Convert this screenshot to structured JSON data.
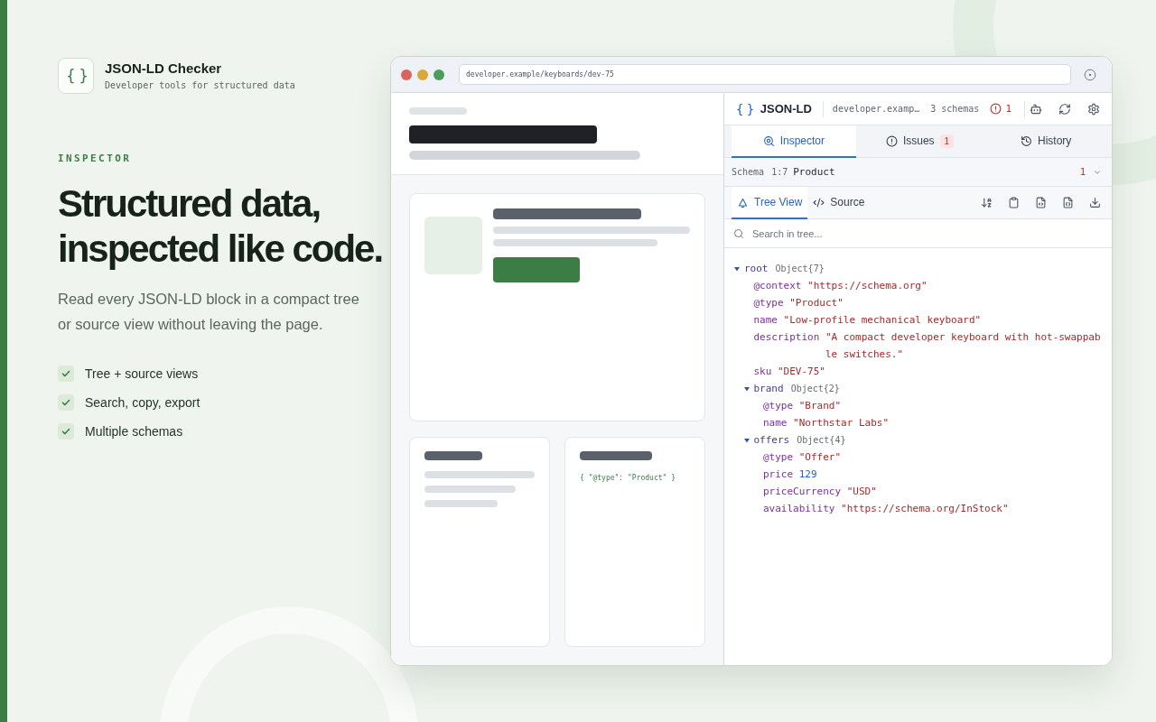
{
  "brand": {
    "logo": "{ }",
    "title": "JSON-LD Checker",
    "subtitle": "Developer tools for structured data"
  },
  "hero": {
    "eyebrow": "INSPECTOR",
    "headline": "Structured data, inspected like code.",
    "lead": "Read every JSON-LD block in a compact tree or source view without leaving the page.",
    "features": [
      "Tree + source views",
      "Search, copy, export",
      "Multiple schemas"
    ]
  },
  "browser": {
    "url": "developer.example/keyboards/dev-75",
    "page": {
      "code_snippet": "{ \"@type\": \"Product\" }"
    }
  },
  "panel": {
    "logo": "{ }",
    "title": "JSON-LD",
    "site": "developer.examp…",
    "schemas": "3 schemas",
    "issue_count": "1",
    "tabs": [
      {
        "label": "Inspector",
        "selected": true
      },
      {
        "label": "Issues",
        "selected": false,
        "badge": "1"
      },
      {
        "label": "History",
        "selected": false
      }
    ],
    "schema_bar": {
      "label": "Schema",
      "position": "1:7",
      "type": "Product",
      "issue_count": "1"
    },
    "view_tabs": [
      {
        "label": "Tree View",
        "selected": true
      },
      {
        "label": "Source",
        "selected": false
      }
    ],
    "search": {
      "placeholder": "Search in tree..."
    },
    "tree": {
      "key": "root",
      "kind": "object",
      "summary": "Object{7}",
      "expanded": true,
      "children": [
        {
          "key": "@context",
          "kind": "string",
          "value": "\"https://schema.org\""
        },
        {
          "key": "@type",
          "kind": "string",
          "value": "\"Product\""
        },
        {
          "key": "name",
          "kind": "string",
          "value": "\"Low-profile mechanical keyboard\""
        },
        {
          "key": "description",
          "kind": "string",
          "value": "\"A compact developer keyboard with hot-swappable switches.\""
        },
        {
          "key": "sku",
          "kind": "string",
          "value": "\"DEV-75\""
        },
        {
          "key": "brand",
          "kind": "object",
          "summary": "Object{2}",
          "expanded": true,
          "children": [
            {
              "key": "@type",
              "kind": "string",
              "value": "\"Brand\""
            },
            {
              "key": "name",
              "kind": "string",
              "value": "\"Northstar Labs\""
            }
          ]
        },
        {
          "key": "offers",
          "kind": "object",
          "summary": "Object{4}",
          "expanded": true,
          "children": [
            {
              "key": "@type",
              "kind": "string",
              "value": "\"Offer\""
            },
            {
              "key": "price",
              "kind": "number",
              "value": "129"
            },
            {
              "key": "priceCurrency",
              "kind": "string",
              "value": "\"USD\""
            },
            {
              "key": "availability",
              "kind": "string",
              "value": "\"https://schema.org/InStock\""
            }
          ]
        }
      ]
    }
  }
}
